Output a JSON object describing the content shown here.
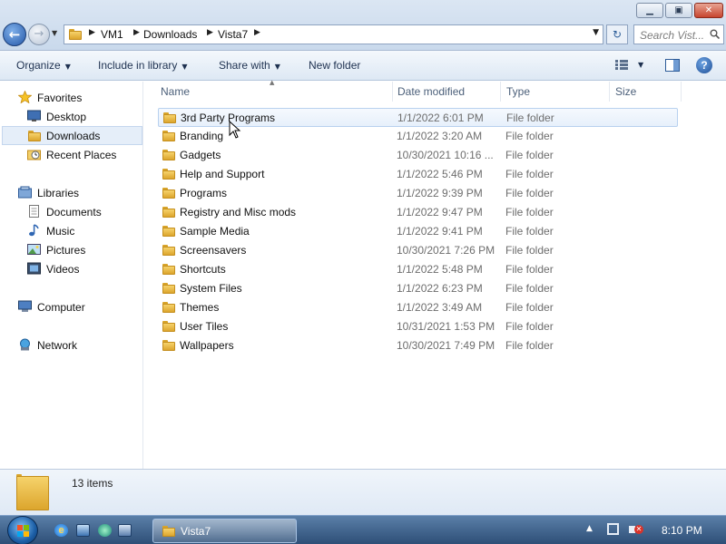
{
  "window": {
    "minimize_glyph": "▁",
    "maximize_glyph": "▣",
    "close_glyph": "✕"
  },
  "nav": {
    "back_glyph": "←",
    "forward_glyph": "→",
    "recent_glyph": "▼"
  },
  "address": {
    "crumbs": [
      "VM1",
      "Downloads",
      "Vista7"
    ],
    "separator": "▶",
    "dropdown_glyph": "▼"
  },
  "refresh_glyph": "↻",
  "search": {
    "placeholder": "Search Vist..."
  },
  "toolbar": {
    "organize": "Organize",
    "include_in_library": "Include in library",
    "share_with": "Share with",
    "new_folder": "New folder",
    "caret": "▼",
    "help": "?"
  },
  "navpane": {
    "favorites": {
      "label": "Favorites",
      "items": [
        "Desktop",
        "Downloads",
        "Recent Places"
      ]
    },
    "libraries": {
      "label": "Libraries",
      "items": [
        "Documents",
        "Music",
        "Pictures",
        "Videos"
      ]
    },
    "computer": "Computer",
    "network": "Network",
    "selected": "Downloads"
  },
  "filelist": {
    "columns": [
      "Name",
      "Date modified",
      "Type",
      "Size"
    ],
    "sort_glyph": "▲",
    "rows": [
      {
        "name": "3rd Party Programs",
        "date": "1/1/2022 6:01 PM",
        "type": "File folder"
      },
      {
        "name": "Branding",
        "date": "1/1/2022 3:20 AM",
        "type": "File folder"
      },
      {
        "name": "Gadgets",
        "date": "10/30/2021 10:16 ...",
        "type": "File folder"
      },
      {
        "name": "Help and Support",
        "date": "1/1/2022 5:46 PM",
        "type": "File folder"
      },
      {
        "name": "Programs",
        "date": "1/1/2022 9:39 PM",
        "type": "File folder"
      },
      {
        "name": "Registry and Misc mods",
        "date": "1/1/2022 9:47 PM",
        "type": "File folder"
      },
      {
        "name": "Sample Media",
        "date": "1/1/2022 9:41 PM",
        "type": "File folder"
      },
      {
        "name": "Screensavers",
        "date": "10/30/2021 7:26 PM",
        "type": "File folder"
      },
      {
        "name": "Shortcuts",
        "date": "1/1/2022 5:48 PM",
        "type": "File folder"
      },
      {
        "name": "System Files",
        "date": "1/1/2022 6:23 PM",
        "type": "File folder"
      },
      {
        "name": "Themes",
        "date": "1/1/2022 3:49 AM",
        "type": "File folder"
      },
      {
        "name": "User Tiles",
        "date": "10/31/2021 1:53 PM",
        "type": "File folder"
      },
      {
        "name": "Wallpapers",
        "date": "10/30/2021 7:49 PM",
        "type": "File folder"
      }
    ],
    "hovered_row": "3rd Party Programs"
  },
  "details": {
    "items_count": "13 items"
  },
  "taskbar": {
    "active_window": "Vista7",
    "ie_glyph": "e",
    "tray_up_glyph": "▲",
    "mute_glyph": "✕",
    "clock": "8:10 PM"
  },
  "colors": {
    "accent": "#2457a8",
    "selection": "#e5eef9",
    "taskbar": "#2e4f77",
    "folder": "#f6d36b"
  }
}
